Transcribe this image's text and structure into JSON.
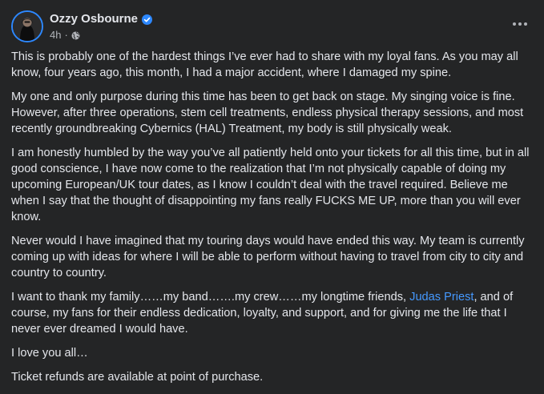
{
  "post": {
    "author": "Ozzy Osbourne",
    "time": "4h",
    "separator": "·",
    "verified_icon": "verified-badge-icon",
    "privacy_icon": "globe-icon",
    "more_icon": "more-options-icon",
    "paragraphs": [
      "This is probably one of the hardest things I’ve ever had to share with my loyal fans.  As you may all know, four years ago, this month, I had a major accident, where I damaged my spine.",
      "My one and only purpose during this time has been to get back on stage.  My singing voice is fine.  However, after three operations, stem cell treatments, endless physical therapy sessions, and most recently groundbreaking Cybernics (HAL) Treatment, my body is still physically weak.",
      "I am honestly humbled by the way you’ve all patiently held onto your tickets for all this time, but in all good conscience, I have now come to the realization that I’m not physically capable of doing my upcoming European/UK tour dates, as I know I couldn’t deal with the travel required.  Believe me when I say that the thought of disappointing my fans really FUCKS ME UP, more than you will ever know.",
      "Never would I have imagined that my touring days would have ended this way.  My team is currently coming up with ideas for where I will be able to perform without having to travel from city to city and country to country."
    ],
    "thanks_before": "I want to thank my family……my band…….my crew……my longtime friends, ",
    "thanks_link": "Judas Priest",
    "thanks_after": ", and of course, my fans for their endless dedication, loyalty, and support, and for giving me the life that I never ever dreamed I would have.",
    "closing": "I love you all…",
    "refunds": "Ticket refunds are available at point of purchase."
  },
  "colors": {
    "background": "#242526",
    "text": "#e4e6eb",
    "secondary": "#b0b3b8",
    "link": "#4599ff",
    "verified": "#2d88ff"
  }
}
